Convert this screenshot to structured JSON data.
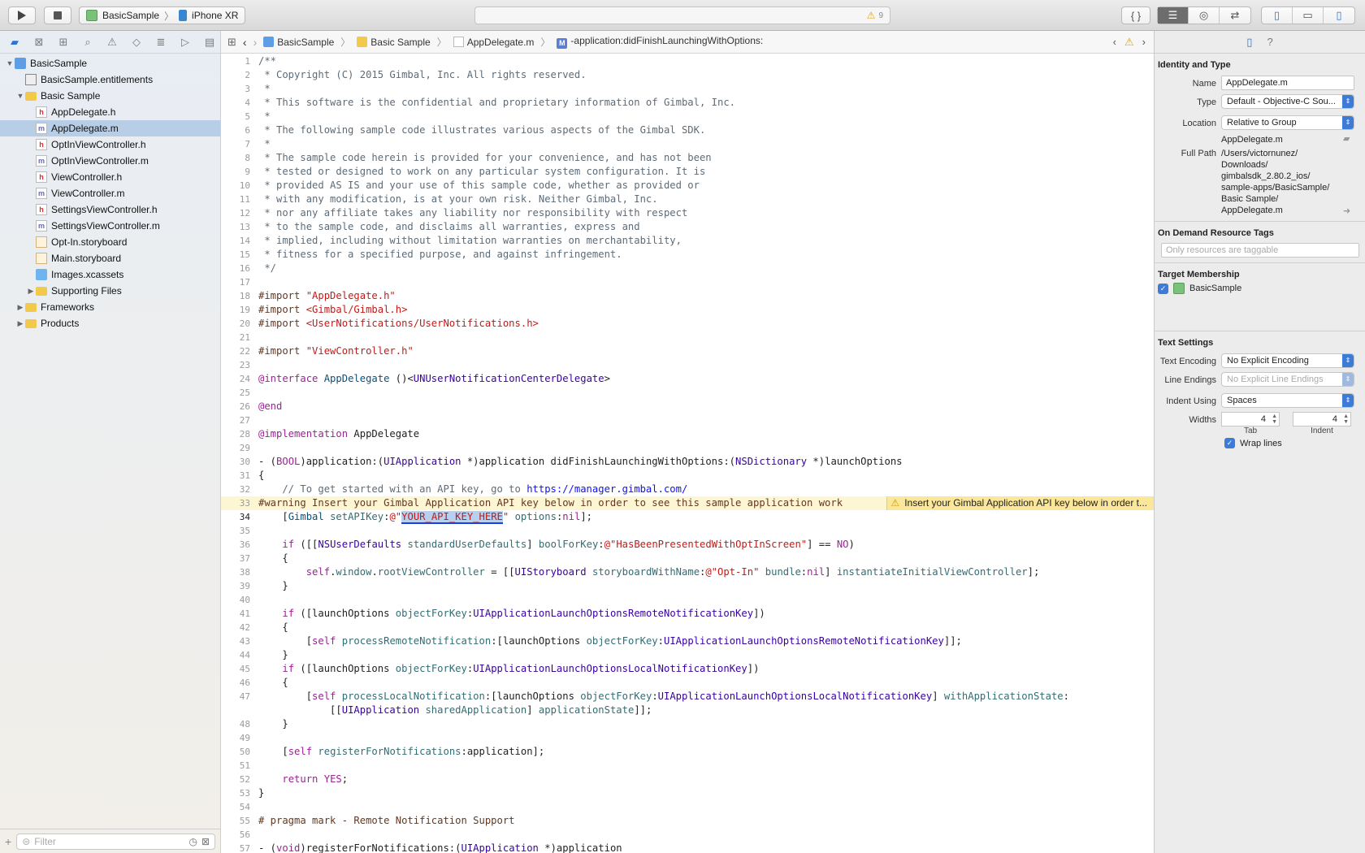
{
  "toolbar": {
    "scheme": "BasicSample",
    "device": "iPhone XR",
    "warning_count": "9"
  },
  "navigator": {
    "filter_placeholder": "Filter",
    "items": [
      {
        "label": "BasicSample",
        "icon": "project-icon",
        "depth": 0,
        "disclosure": "open"
      },
      {
        "label": "BasicSample.entitlements",
        "icon": "entitlements-file-icon",
        "depth": 1,
        "disclosure": ""
      },
      {
        "label": "Basic Sample",
        "icon": "folder-icon",
        "depth": 1,
        "disclosure": "open"
      },
      {
        "label": "AppDelegate.h",
        "icon": "header-file-icon",
        "depth": 2,
        "disclosure": ""
      },
      {
        "label": "AppDelegate.m",
        "icon": "implementation-file-icon",
        "depth": 2,
        "disclosure": "",
        "selected": true
      },
      {
        "label": "OptInViewController.h",
        "icon": "header-file-icon",
        "depth": 2,
        "disclosure": ""
      },
      {
        "label": "OptInViewController.m",
        "icon": "implementation-file-icon",
        "depth": 2,
        "disclosure": ""
      },
      {
        "label": "ViewController.h",
        "icon": "header-file-icon",
        "depth": 2,
        "disclosure": ""
      },
      {
        "label": "ViewController.m",
        "icon": "implementation-file-icon",
        "depth": 2,
        "disclosure": ""
      },
      {
        "label": "SettingsViewController.h",
        "icon": "header-file-icon",
        "depth": 2,
        "disclosure": ""
      },
      {
        "label": "SettingsViewController.m",
        "icon": "implementation-file-icon",
        "depth": 2,
        "disclosure": ""
      },
      {
        "label": "Opt-In.storyboard",
        "icon": "storyboard-file-icon",
        "depth": 2,
        "disclosure": ""
      },
      {
        "label": "Main.storyboard",
        "icon": "storyboard-file-icon",
        "depth": 2,
        "disclosure": ""
      },
      {
        "label": "Images.xcassets",
        "icon": "asset-catalog-icon",
        "depth": 2,
        "disclosure": ""
      },
      {
        "label": "Supporting Files",
        "icon": "folder-icon",
        "depth": 2,
        "disclosure": "closed"
      },
      {
        "label": "Frameworks",
        "icon": "folder-icon",
        "depth": 1,
        "disclosure": "closed"
      },
      {
        "label": "Products",
        "icon": "folder-icon",
        "depth": 1,
        "disclosure": "closed"
      }
    ]
  },
  "jumpbar": {
    "project": "BasicSample",
    "group": "Basic Sample",
    "file": "AppDelegate.m",
    "method_badge": "M",
    "method": "-application:didFinishLaunchingWithOptions:"
  },
  "editor": {
    "warning_badge": "Insert your Gimbal Application API key below in order t...",
    "warning_line": 33,
    "current_line": 34,
    "lines": [
      {
        "n": "1",
        "segs": [
          [
            "c-com",
            "/**"
          ]
        ]
      },
      {
        "n": "2",
        "segs": [
          [
            "c-com",
            " * Copyright (C) 2015 Gimbal, Inc. All rights reserved."
          ]
        ]
      },
      {
        "n": "3",
        "segs": [
          [
            "c-com",
            " *"
          ]
        ]
      },
      {
        "n": "4",
        "segs": [
          [
            "c-com",
            " * This software is the confidential and proprietary information of Gimbal, Inc."
          ]
        ]
      },
      {
        "n": "5",
        "segs": [
          [
            "c-com",
            " *"
          ]
        ]
      },
      {
        "n": "6",
        "segs": [
          [
            "c-com",
            " * The following sample code illustrates various aspects of the Gimbal SDK."
          ]
        ]
      },
      {
        "n": "7",
        "segs": [
          [
            "c-com",
            " *"
          ]
        ]
      },
      {
        "n": "8",
        "segs": [
          [
            "c-com",
            " * The sample code herein is provided for your convenience, and has not been"
          ]
        ]
      },
      {
        "n": "9",
        "segs": [
          [
            "c-com",
            " * tested or designed to work on any particular system configuration. It is"
          ]
        ]
      },
      {
        "n": "10",
        "segs": [
          [
            "c-com",
            " * provided AS IS and your use of this sample code, whether as provided or"
          ]
        ]
      },
      {
        "n": "11",
        "segs": [
          [
            "c-com",
            " * with any modification, is at your own risk. Neither Gimbal, Inc."
          ]
        ]
      },
      {
        "n": "12",
        "segs": [
          [
            "c-com",
            " * nor any affiliate takes any liability nor responsibility with respect"
          ]
        ]
      },
      {
        "n": "13",
        "segs": [
          [
            "c-com",
            " * to the sample code, and disclaims all warranties, express and"
          ]
        ]
      },
      {
        "n": "14",
        "segs": [
          [
            "c-com",
            " * implied, including without limitation warranties on merchantability,"
          ]
        ]
      },
      {
        "n": "15",
        "segs": [
          [
            "c-com",
            " * fitness for a specified purpose, and against infringement."
          ]
        ]
      },
      {
        "n": "16",
        "segs": [
          [
            "c-com",
            " */"
          ]
        ]
      },
      {
        "n": "17",
        "segs": []
      },
      {
        "n": "18",
        "segs": [
          [
            "c-pp",
            "#import "
          ],
          [
            "c-str",
            "\"AppDelegate.h\""
          ]
        ]
      },
      {
        "n": "19",
        "segs": [
          [
            "c-pp",
            "#import "
          ],
          [
            "c-str",
            "<Gimbal/Gimbal.h>"
          ]
        ]
      },
      {
        "n": "20",
        "segs": [
          [
            "c-pp",
            "#import "
          ],
          [
            "c-str",
            "<UserNotifications/UserNotifications.h>"
          ]
        ]
      },
      {
        "n": "21",
        "segs": []
      },
      {
        "n": "22",
        "segs": [
          [
            "c-pp",
            "#import "
          ],
          [
            "c-str",
            "\"ViewController.h\""
          ]
        ]
      },
      {
        "n": "23",
        "segs": []
      },
      {
        "n": "24",
        "segs": [
          [
            "c-kw",
            "@interface"
          ],
          [
            "",
            " "
          ],
          [
            "c-cls",
            "AppDelegate"
          ],
          [
            "",
            " ()<"
          ],
          [
            "c-type",
            "UNUserNotificationCenterDelegate"
          ],
          [
            "",
            ">"
          ]
        ]
      },
      {
        "n": "25",
        "segs": []
      },
      {
        "n": "26",
        "segs": [
          [
            "c-kw",
            "@end"
          ]
        ]
      },
      {
        "n": "27",
        "segs": []
      },
      {
        "n": "28",
        "segs": [
          [
            "c-kw",
            "@implementation"
          ],
          [
            "",
            " AppDelegate"
          ]
        ]
      },
      {
        "n": "29",
        "segs": []
      },
      {
        "n": "30",
        "segs": [
          [
            "",
            "- ("
          ],
          [
            "c-kw",
            "BOOL"
          ],
          [
            "",
            ")application:("
          ],
          [
            "c-type",
            "UIApplication"
          ],
          [
            "",
            " *)application didFinishLaunchingWithOptions:("
          ],
          [
            "c-type",
            "NSDictionary"
          ],
          [
            "",
            " *)launchOptions"
          ]
        ]
      },
      {
        "n": "31",
        "segs": [
          [
            "",
            "{"
          ]
        ]
      },
      {
        "n": "32",
        "segs": [
          [
            "c-com",
            "    // To get started with an API key, go to "
          ],
          [
            "c-url",
            "https://manager.gimbal.com/"
          ]
        ]
      },
      {
        "n": "33",
        "segs": [
          [
            "c-warn",
            "#warning Insert your Gimbal Application API key below in order to see this sample application work"
          ]
        ]
      },
      {
        "n": "34",
        "segs": [
          [
            "",
            "    ["
          ],
          [
            "c-cls",
            "Gimbal"
          ],
          [
            "",
            " "
          ],
          [
            "c-meth",
            "setAPIKey"
          ],
          [
            "",
            ":"
          ],
          [
            "c-str",
            "@\""
          ],
          [
            "sel-str",
            "YOUR_API_KEY_HERE"
          ],
          [
            "c-str",
            "\""
          ],
          [
            "",
            " "
          ],
          [
            "c-meth",
            "options"
          ],
          [
            "",
            ":"
          ],
          [
            "c-kw",
            "nil"
          ],
          [
            "",
            "];"
          ]
        ]
      },
      {
        "n": "35",
        "segs": []
      },
      {
        "n": "36",
        "segs": [
          [
            "",
            "    "
          ],
          [
            "c-kw",
            "if"
          ],
          [
            "",
            " ([["
          ],
          [
            "c-type",
            "NSUserDefaults"
          ],
          [
            "",
            " "
          ],
          [
            "c-meth",
            "standardUserDefaults"
          ],
          [
            "",
            "] "
          ],
          [
            "c-meth",
            "boolForKey"
          ],
          [
            "",
            ":"
          ],
          [
            "c-str",
            "@\"HasBeenPresentedWithOptInScreen\""
          ],
          [
            "",
            "] == "
          ],
          [
            "c-kw",
            "NO"
          ],
          [
            "",
            ")"
          ]
        ]
      },
      {
        "n": "37",
        "segs": [
          [
            "",
            "    {"
          ]
        ]
      },
      {
        "n": "38",
        "segs": [
          [
            "",
            "        "
          ],
          [
            "c-kw",
            "self"
          ],
          [
            "",
            "."
          ],
          [
            "c-meth",
            "window"
          ],
          [
            "",
            "."
          ],
          [
            "c-meth",
            "rootViewController"
          ],
          [
            "",
            " = [["
          ],
          [
            "c-type",
            "UIStoryboard"
          ],
          [
            "",
            " "
          ],
          [
            "c-meth",
            "storyboardWithName"
          ],
          [
            "",
            ":"
          ],
          [
            "c-str",
            "@\"Opt-In\""
          ],
          [
            "",
            " "
          ],
          [
            "c-meth",
            "bundle"
          ],
          [
            "",
            ":"
          ],
          [
            "c-kw",
            "nil"
          ],
          [
            "",
            "] "
          ],
          [
            "c-meth",
            "instantiateInitialViewController"
          ],
          [
            "",
            "];"
          ]
        ]
      },
      {
        "n": "39",
        "segs": [
          [
            "",
            "    }"
          ]
        ]
      },
      {
        "n": "40",
        "segs": []
      },
      {
        "n": "41",
        "segs": [
          [
            "",
            "    "
          ],
          [
            "c-kw",
            "if"
          ],
          [
            "",
            " ([launchOptions "
          ],
          [
            "c-meth",
            "objectForKey"
          ],
          [
            "",
            ":"
          ],
          [
            "c-type",
            "UIApplicationLaunchOptionsRemoteNotificationKey"
          ],
          [
            "",
            "])"
          ]
        ]
      },
      {
        "n": "42",
        "segs": [
          [
            "",
            "    {"
          ]
        ]
      },
      {
        "n": "43",
        "segs": [
          [
            "",
            "        ["
          ],
          [
            "c-kw",
            "self"
          ],
          [
            "",
            " "
          ],
          [
            "c-meth",
            "processRemoteNotification"
          ],
          [
            "",
            ":[launchOptions "
          ],
          [
            "c-meth",
            "objectForKey"
          ],
          [
            "",
            ":"
          ],
          [
            "c-type",
            "UIApplicationLaunchOptionsRemoteNotificationKey"
          ],
          [
            "",
            "]];"
          ]
        ]
      },
      {
        "n": "44",
        "segs": [
          [
            "",
            "    }"
          ]
        ]
      },
      {
        "n": "45",
        "segs": [
          [
            "",
            "    "
          ],
          [
            "c-kw",
            "if"
          ],
          [
            "",
            " ([launchOptions "
          ],
          [
            "c-meth",
            "objectForKey"
          ],
          [
            "",
            ":"
          ],
          [
            "c-type",
            "UIApplicationLaunchOptionsLocalNotificationKey"
          ],
          [
            "",
            "])"
          ]
        ]
      },
      {
        "n": "46",
        "segs": [
          [
            "",
            "    {"
          ]
        ]
      },
      {
        "n": "47",
        "segs": [
          [
            "",
            "        ["
          ],
          [
            "c-kw",
            "self"
          ],
          [
            "",
            " "
          ],
          [
            "c-meth",
            "processLocalNotification"
          ],
          [
            "",
            ":[launchOptions "
          ],
          [
            "c-meth",
            "objectForKey"
          ],
          [
            "",
            ":"
          ],
          [
            "c-type",
            "UIApplicationLaunchOptionsLocalNotificationKey"
          ],
          [
            "",
            "] "
          ],
          [
            "c-meth",
            "withApplicationState"
          ],
          [
            "",
            ":"
          ]
        ]
      },
      {
        "n": "",
        "segs": [
          [
            "",
            "            [["
          ],
          [
            "c-type",
            "UIApplication"
          ],
          [
            "",
            " "
          ],
          [
            "c-meth",
            "sharedApplication"
          ],
          [
            "",
            "] "
          ],
          [
            "c-meth",
            "applicationState"
          ],
          [
            "",
            "]];"
          ]
        ]
      },
      {
        "n": "48",
        "segs": [
          [
            "",
            "    }"
          ]
        ]
      },
      {
        "n": "49",
        "segs": []
      },
      {
        "n": "50",
        "segs": [
          [
            "",
            "    ["
          ],
          [
            "c-kw",
            "self"
          ],
          [
            "",
            " "
          ],
          [
            "c-meth",
            "registerForNotifications"
          ],
          [
            "",
            ":application];"
          ]
        ]
      },
      {
        "n": "51",
        "segs": []
      },
      {
        "n": "52",
        "segs": [
          [
            "",
            "    "
          ],
          [
            "c-kw",
            "return"
          ],
          [
            "",
            " "
          ],
          [
            "c-kw",
            "YES"
          ],
          [
            "",
            ";"
          ]
        ]
      },
      {
        "n": "53",
        "segs": [
          [
            "",
            "}"
          ]
        ]
      },
      {
        "n": "54",
        "segs": []
      },
      {
        "n": "55",
        "segs": [
          [
            "c-pp",
            "# pragma mark - Remote Notification Support"
          ]
        ]
      },
      {
        "n": "56",
        "segs": []
      },
      {
        "n": "57",
        "segs": [
          [
            "",
            "- ("
          ],
          [
            "c-kw",
            "void"
          ],
          [
            "",
            ")registerForNotifications:("
          ],
          [
            "c-type",
            "UIApplication"
          ],
          [
            "",
            " *)application"
          ]
        ]
      }
    ]
  },
  "inspector": {
    "identity_title": "Identity and Type",
    "name_label": "Name",
    "name_value": "AppDelegate.m",
    "type_label": "Type",
    "type_value": "Default - Objective-C Sou...",
    "location_label": "Location",
    "location_value": "Relative to Group",
    "location_file": "AppDelegate.m",
    "fullpath_label": "Full Path",
    "fullpath_lines": [
      "/Users/victornunez/",
      "Downloads/",
      "gimbalsdk_2.80.2_ios/",
      "sample-apps/BasicSample/",
      "Basic Sample/",
      "AppDelegate.m"
    ],
    "odr_title": "On Demand Resource Tags",
    "odr_placeholder": "Only resources are taggable",
    "target_title": "Target Membership",
    "target_name": "BasicSample",
    "text_title": "Text Settings",
    "encoding_label": "Text Encoding",
    "encoding_value": "No Explicit Encoding",
    "line_endings_label": "Line Endings",
    "line_endings_value": "No Explicit Line Endings",
    "indent_using_label": "Indent Using",
    "indent_using_value": "Spaces",
    "widths_label": "Widths",
    "tab_width": "4",
    "indent_width": "4",
    "tab_label": "Tab",
    "indent_label": "Indent",
    "wrap_lines_label": "Wrap lines"
  }
}
